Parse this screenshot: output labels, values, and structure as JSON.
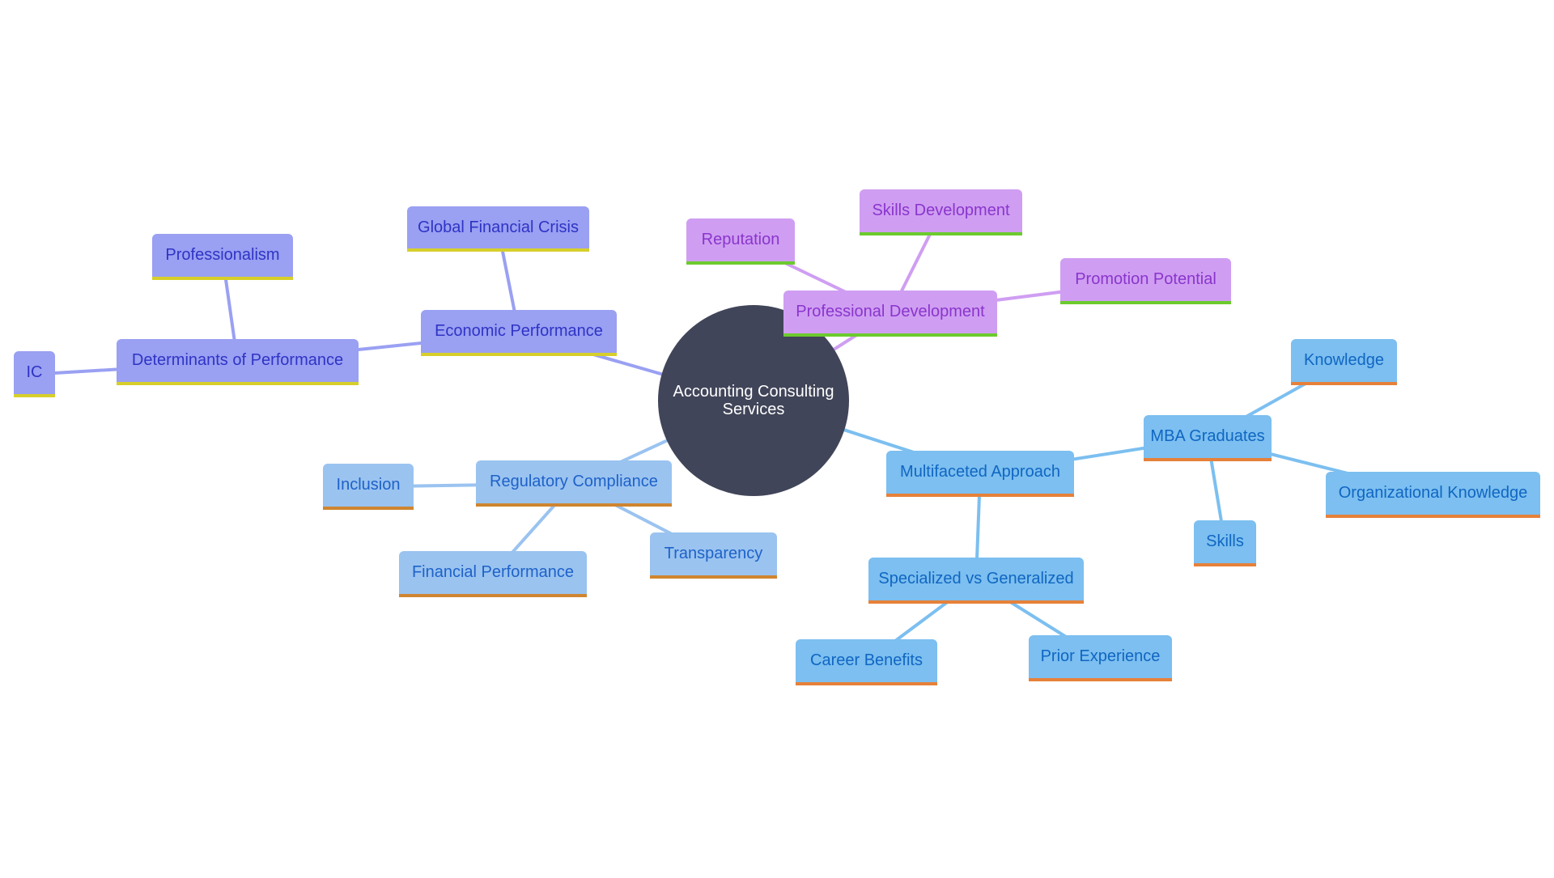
{
  "diagram": {
    "type": "mindmap",
    "root": {
      "id": "root",
      "label": "Accounting Consulting Services",
      "fill": "#414559",
      "text": "#ffffff"
    },
    "branches": {
      "indigo": {
        "fill": "#9aa0f2",
        "text": "#2e34c4",
        "underline": "#d6cf2b",
        "edge": "#9aa0f2"
      },
      "purple": {
        "fill": "#cf9ef2",
        "text": "#8a35cc",
        "underline": "#6ccb2e",
        "edge": "#cf9ef2"
      },
      "lightblue": {
        "fill": "#9ac3f0",
        "text": "#1e62c8",
        "underline": "#cf8530",
        "edge": "#9ac3f0"
      },
      "skyblue": {
        "fill": "#7cbff0",
        "text": "#1066c2",
        "underline": "#e6813a",
        "edge": "#7cbff0"
      }
    },
    "nodes": [
      {
        "id": "econ",
        "label": "Economic Performance",
        "parent": "root",
        "branch": "indigo"
      },
      {
        "id": "gfc",
        "label": "Global Financial Crisis",
        "parent": "econ",
        "branch": "indigo"
      },
      {
        "id": "det",
        "label": "Determinants of Performance",
        "parent": "econ",
        "branch": "indigo"
      },
      {
        "id": "prof",
        "label": "Professionalism",
        "parent": "det",
        "branch": "indigo"
      },
      {
        "id": "ic",
        "label": "IC",
        "parent": "det",
        "branch": "indigo"
      },
      {
        "id": "pd",
        "label": "Professional Development",
        "parent": "root",
        "branch": "purple"
      },
      {
        "id": "rep",
        "label": "Reputation",
        "parent": "pd",
        "branch": "purple"
      },
      {
        "id": "sd",
        "label": "Skills Development",
        "parent": "pd",
        "branch": "purple"
      },
      {
        "id": "pp",
        "label": "Promotion Potential",
        "parent": "pd",
        "branch": "purple"
      },
      {
        "id": "reg",
        "label": "Regulatory Compliance",
        "parent": "root",
        "branch": "lightblue"
      },
      {
        "id": "inc",
        "label": "Inclusion",
        "parent": "reg",
        "branch": "lightblue"
      },
      {
        "id": "fp",
        "label": "Financial Performance",
        "parent": "reg",
        "branch": "lightblue"
      },
      {
        "id": "tr",
        "label": "Transparency",
        "parent": "reg",
        "branch": "lightblue"
      },
      {
        "id": "ma",
        "label": "Multifaceted Approach",
        "parent": "root",
        "branch": "skyblue"
      },
      {
        "id": "mba",
        "label": "MBA Graduates",
        "parent": "ma",
        "branch": "skyblue"
      },
      {
        "id": "kn",
        "label": "Knowledge",
        "parent": "mba",
        "branch": "skyblue"
      },
      {
        "id": "ok",
        "label": "Organizational Knowledge",
        "parent": "mba",
        "branch": "skyblue"
      },
      {
        "id": "sk",
        "label": "Skills",
        "parent": "mba",
        "branch": "skyblue"
      },
      {
        "id": "svg",
        "label": "Specialized vs Generalized",
        "parent": "ma",
        "branch": "skyblue"
      },
      {
        "id": "cb",
        "label": "Career Benefits",
        "parent": "svg",
        "branch": "skyblue"
      },
      {
        "id": "pe",
        "label": "Prior Experience",
        "parent": "svg",
        "branch": "skyblue"
      }
    ]
  }
}
